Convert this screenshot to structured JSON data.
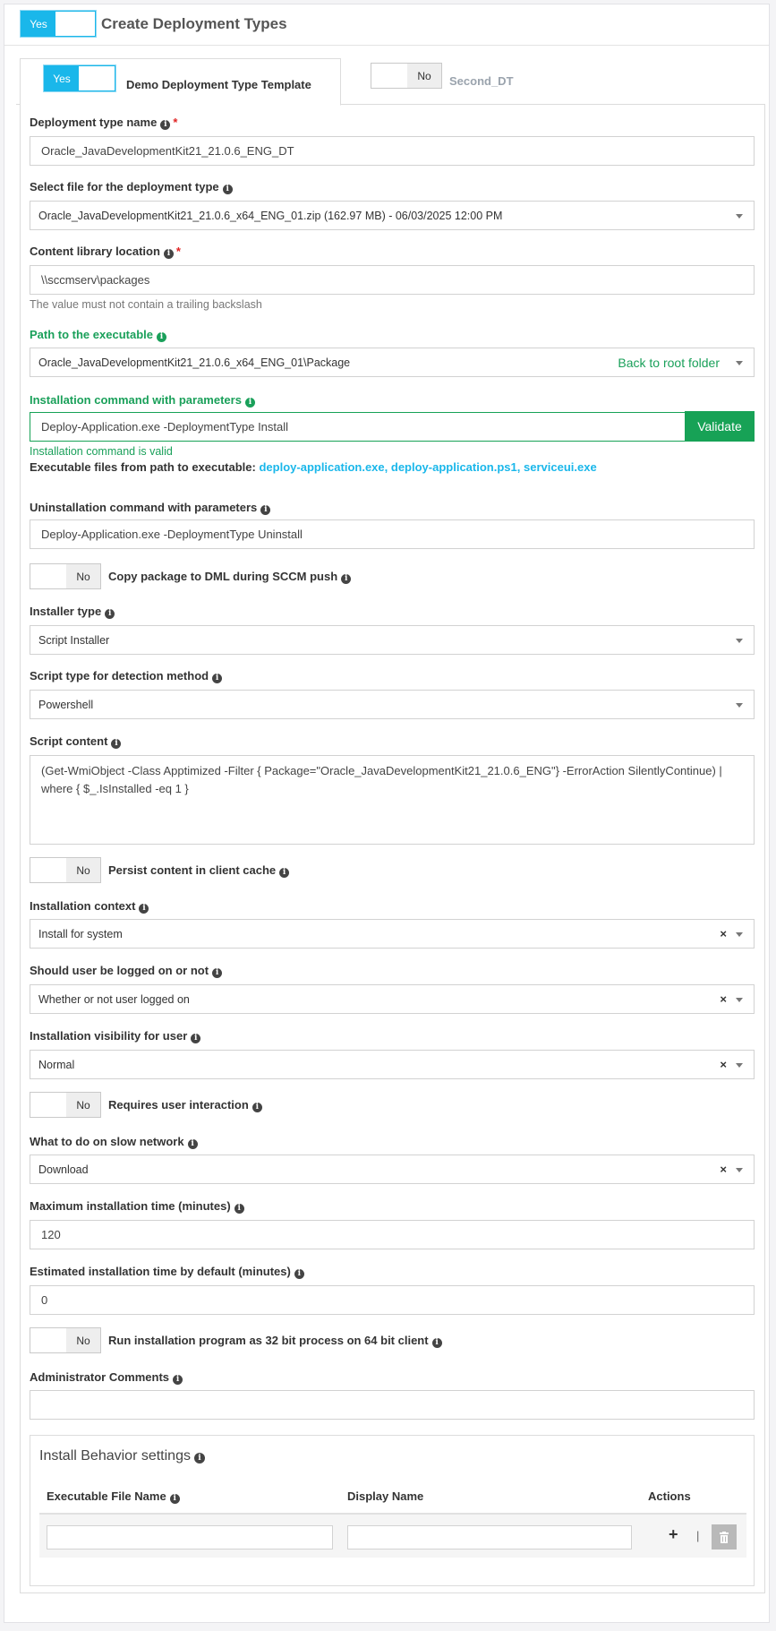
{
  "header": {
    "title": "Create Deployment Types",
    "toggle_label": "Yes"
  },
  "tabs": [
    {
      "label": "Demo Deployment Type Template",
      "toggle_label": "Yes",
      "active": true
    },
    {
      "label": "Second_DT",
      "toggle_label": "No",
      "active": false
    }
  ],
  "form": {
    "dt_name": {
      "label": "Deployment type name",
      "value": "Oracle_JavaDevelopmentKit21_21.0.6_ENG_DT"
    },
    "file": {
      "label": "Select file for the deployment type",
      "value": "Oracle_JavaDevelopmentKit21_21.0.6_x64_ENG_01.zip (162.97 MB) - 06/03/2025 12:00 PM"
    },
    "content_lib": {
      "label": "Content library location",
      "value": "\\\\sccmserv\\packages",
      "hint": "The value must not contain a trailing backslash"
    },
    "exe_path": {
      "label": "Path to the executable",
      "value": "Oracle_JavaDevelopmentKit21_21.0.6_x64_ENG_01\\Package",
      "back_label": "Back to root folder"
    },
    "install_cmd": {
      "label": "Installation command with parameters",
      "value": "Deploy-Application.exe -DeploymentType Install",
      "validate_label": "Validate",
      "valid_text": "Installation command is valid",
      "exe_files_label": "Executable files from path to executable:",
      "exe_files": [
        "deploy-application.exe",
        "deploy-application.ps1",
        "serviceui.exe"
      ]
    },
    "uninstall_cmd": {
      "label": "Uninstallation command with parameters",
      "value": "Deploy-Application.exe -DeploymentType Uninstall"
    },
    "copy_dml": {
      "label": "Copy package to DML during SCCM push",
      "toggle_label": "No"
    },
    "installer_type": {
      "label": "Installer type",
      "value": "Script Installer"
    },
    "script_type": {
      "label": "Script type for detection method",
      "value": "Powershell"
    },
    "script_content": {
      "label": "Script content",
      "value": "(Get-WmiObject -Class Apptimized -Filter { Package=\"Oracle_JavaDevelopmentKit21_21.0.6_ENG\"} -ErrorAction SilentlyContinue) | where { $_.IsInstalled -eq 1 }"
    },
    "persist_cache": {
      "label": "Persist content in client cache",
      "toggle_label": "No"
    },
    "install_context": {
      "label": "Installation context",
      "value": "Install for system"
    },
    "user_logged": {
      "label": "Should user be logged on or not",
      "value": "Whether or not user logged on"
    },
    "visibility": {
      "label": "Installation visibility for user",
      "value": "Normal"
    },
    "user_interaction": {
      "label": "Requires user interaction",
      "toggle_label": "No"
    },
    "slow_network": {
      "label": "What to do on slow network",
      "value": "Download"
    },
    "max_time": {
      "label": "Maximum installation time (minutes)",
      "value": "120"
    },
    "est_time": {
      "label": "Estimated installation time by default (minutes)",
      "value": "0"
    },
    "run_32bit": {
      "label": "Run installation program as 32 bit process on 64 bit client",
      "toggle_label": "No"
    },
    "admin_comments": {
      "label": "Administrator Comments",
      "value": ""
    }
  },
  "behavior": {
    "title": "Install Behavior settings",
    "col_exe": "Executable File Name",
    "col_display": "Display Name",
    "col_actions": "Actions",
    "plus": "+",
    "sep": "|"
  },
  "colors": {
    "accent": "#1ab7ea",
    "success": "#17a256",
    "required": "#e02424"
  }
}
